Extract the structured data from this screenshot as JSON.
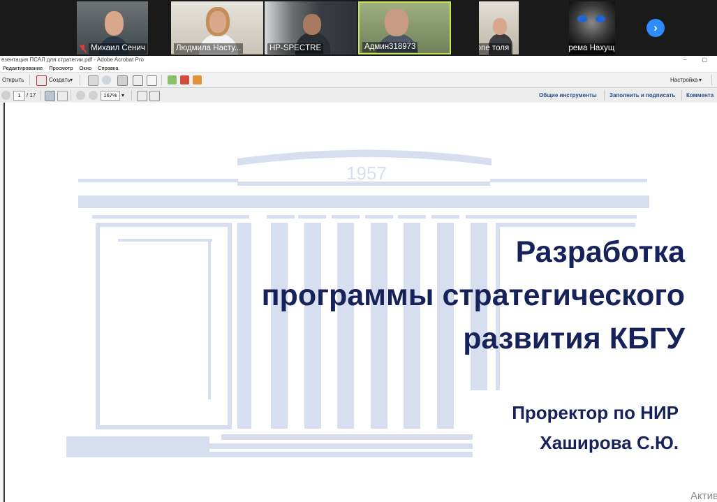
{
  "participants": [
    {
      "name": "Михаил Сенич",
      "muted": true
    },
    {
      "name": "Людмила Насту...",
      "muted": false
    },
    {
      "name": "HP-SPECTRE",
      "muted": false
    },
    {
      "name": "Админ318973",
      "muted": false
    },
    {
      "name": "iPhone толя",
      "muted": true
    },
    {
      "name": "Зарема Нахущ...",
      "muted": true
    }
  ],
  "strip_next_icon": "chevron-right-icon",
  "acrobat": {
    "window_title": "езентация ПСАЛ для стратегии.pdf - Adobe Acrobat Pro",
    "menu": [
      "Редактирование",
      "Просмотр",
      "Окно",
      "Справка"
    ],
    "toolbar": {
      "open_label": "Открыть",
      "create_label": "Создать",
      "customize_label": "Настройка",
      "dropdown_arrow": "▾"
    },
    "nav": {
      "current_page": "1",
      "total_pages": "/ 17",
      "zoom": "167%",
      "tools_label": "Общие инструменты",
      "fill_sign_label": "Заполнить и подписать",
      "comment_label": "Коммента"
    }
  },
  "slide": {
    "year": "1957",
    "title_lines": [
      "Разработка",
      "программы стратегического",
      "развития КБГУ"
    ],
    "subtitle_lines": [
      "Проректор по НИР",
      "Хаширова С.Ю."
    ]
  },
  "windows_activation": "Актив",
  "colors": {
    "slide_text": "#16225a",
    "watermark": "#d6def0",
    "zoom_accent": "#2d8cff",
    "muted_mic": "#e53935"
  }
}
